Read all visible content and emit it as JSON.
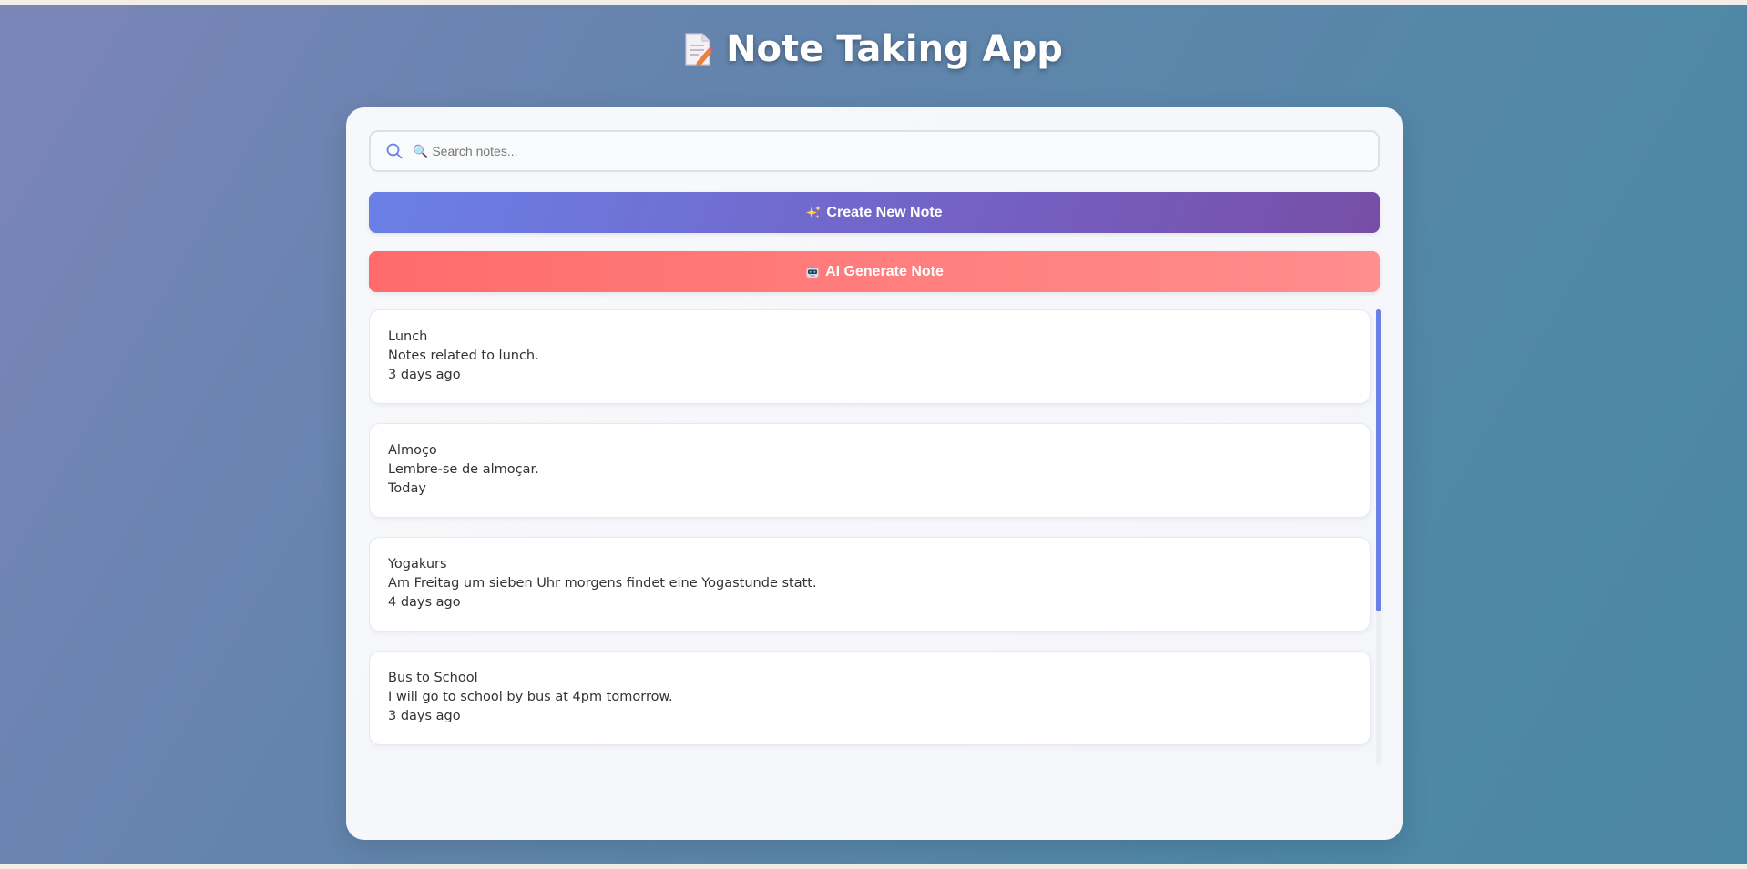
{
  "app": {
    "title": "Note Taking App",
    "title_icon": "memo-icon"
  },
  "search": {
    "placeholder": "🔍 Search notes...",
    "value": "",
    "icon": "search-icon"
  },
  "buttons": {
    "create_label": "Create New Note",
    "create_icon": "sparkles-icon",
    "ai_label": "AI Generate Note",
    "ai_icon": "robot-icon"
  },
  "notes": [
    {
      "title": "Lunch",
      "content": "Notes related to lunch.",
      "date": "3 days ago"
    },
    {
      "title": "Almoço",
      "content": "Lembre-se de almoçar.",
      "date": "Today"
    },
    {
      "title": "Yogakurs",
      "content": "Am Freitag um sieben Uhr morgens findet eine Yogastunde statt.",
      "date": "4 days ago"
    },
    {
      "title": "Bus to School",
      "content": "I will go to school by bus at 4pm tomorrow.",
      "date": "3 days ago"
    }
  ],
  "colors": {
    "accent": "#6a80e6",
    "ai_button": "#ff6b6b",
    "create_button_end": "#774ea6"
  }
}
